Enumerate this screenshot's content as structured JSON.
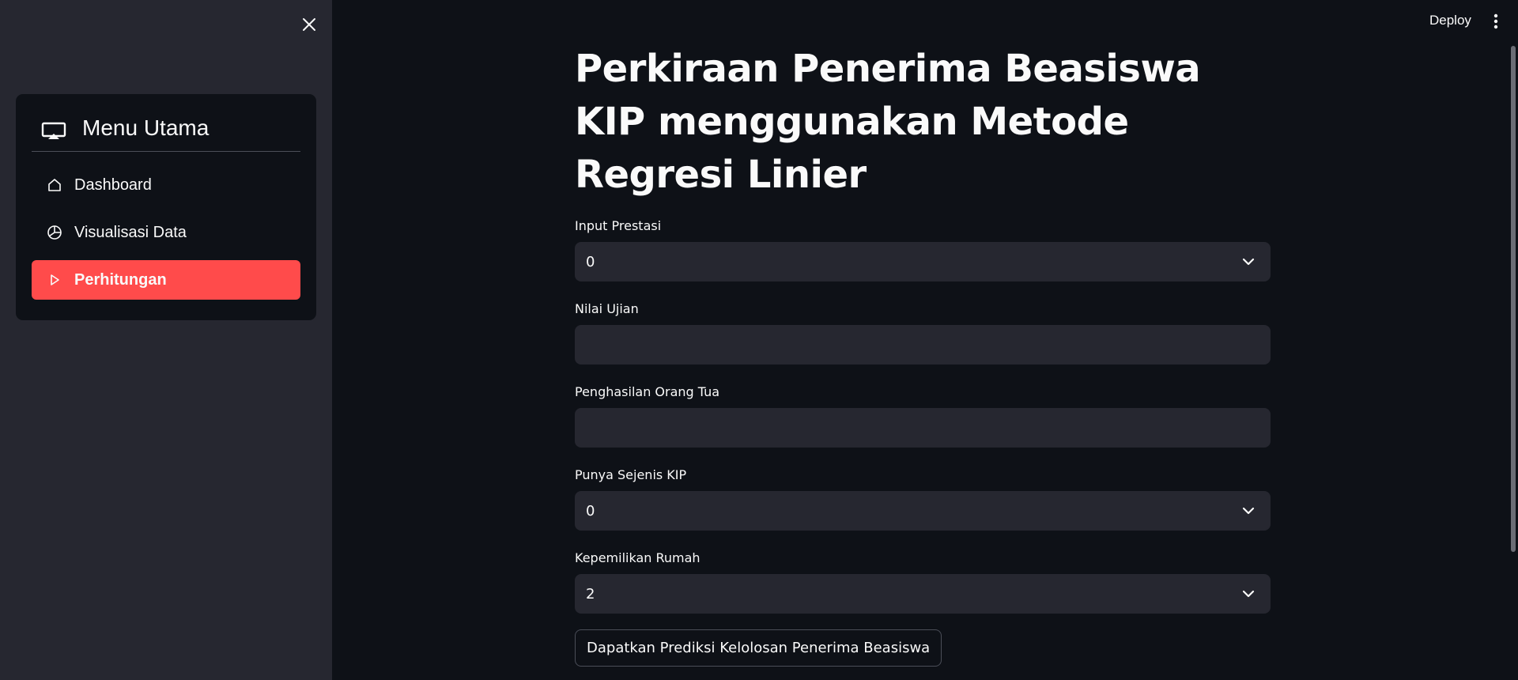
{
  "header": {
    "deploy_label": "Deploy"
  },
  "sidebar": {
    "menu_title": "Menu Utama",
    "items": [
      {
        "label": "Dashboard",
        "icon": "house-icon",
        "active": false
      },
      {
        "label": "Visualisasi Data",
        "icon": "pie-chart-icon",
        "active": false
      },
      {
        "label": "Perhitungan",
        "icon": "play-triangle-icon",
        "active": true
      }
    ],
    "accent_color": "#ff4b4b"
  },
  "main": {
    "title": "Perkiraan Penerima Beasiswa KIP menggunakan Metode Regresi Linier",
    "fields": [
      {
        "label": "Input Prestasi",
        "type": "select",
        "value": "0"
      },
      {
        "label": "Nilai Ujian",
        "type": "text",
        "value": ""
      },
      {
        "label": "Penghasilan Orang Tua",
        "type": "text",
        "value": ""
      },
      {
        "label": "Punya Sejenis KIP",
        "type": "select",
        "value": "0"
      },
      {
        "label": "Kepemilikan Rumah",
        "type": "select",
        "value": "2"
      }
    ],
    "submit_label": "Dapatkan Prediksi Kelolosan Penerima Beasiswa"
  }
}
